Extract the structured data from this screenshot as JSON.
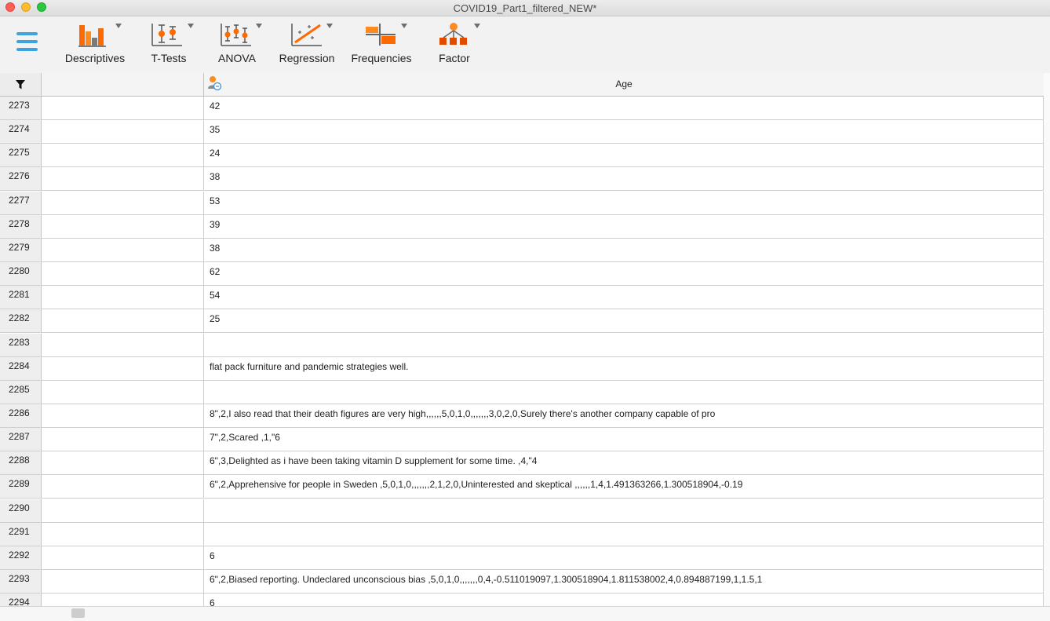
{
  "window": {
    "title": "COVID19_Part1_filtered_NEW*"
  },
  "ribbon": {
    "tools": [
      {
        "label": "Descriptives"
      },
      {
        "label": "T-Tests"
      },
      {
        "label": "ANOVA"
      },
      {
        "label": "Regression"
      },
      {
        "label": "Frequencies"
      },
      {
        "label": "Factor"
      }
    ]
  },
  "grid": {
    "column_header": "Age",
    "rows": [
      {
        "n": "2273",
        "value": "42"
      },
      {
        "n": "2274",
        "value": "35"
      },
      {
        "n": "2275",
        "value": "24"
      },
      {
        "n": "2276",
        "value": "38"
      },
      {
        "n": "2277",
        "value": "53"
      },
      {
        "n": "2278",
        "value": "39"
      },
      {
        "n": "2279",
        "value": "38"
      },
      {
        "n": "2280",
        "value": "62"
      },
      {
        "n": "2281",
        "value": "54"
      },
      {
        "n": "2282",
        "value": "25"
      },
      {
        "n": "2283",
        "value": ""
      },
      {
        "n": "2284",
        "value": "flat pack furniture and pandemic strategies well."
      },
      {
        "n": "2285",
        "value": ""
      },
      {
        "n": "2286",
        "value": "8\",2,I also read that their death figures are very high,,,,,,5,0,1,0,,,,,,,3,0,2,0,Surely there's another company capable of pro"
      },
      {
        "n": "2287",
        "value": "7\",2,Scared ,1,\"6"
      },
      {
        "n": "2288",
        "value": "6\",3,Delighted as i have been taking vitamin D supplement for some time. ,4,\"4"
      },
      {
        "n": "2289",
        "value": "6\",2,Apprehensive for people in Sweden ,5,0,1,0,,,,,,,2,1,2,0,Uninterested and skeptical ,,,,,,1,4,1.491363266,1.300518904,-0.19"
      },
      {
        "n": "2290",
        "value": ""
      },
      {
        "n": "2291",
        "value": ""
      },
      {
        "n": "2292",
        "value": "6"
      },
      {
        "n": "2293",
        "value": "6\",2,Biased reporting. Undeclared unconscious bias ,5,0,1,0,,,,,,,0,4,-0.511019097,1.300518904,1.811538002,4,0.894887199,1,1.5,1"
      },
      {
        "n": "2294",
        "value": "6"
      }
    ]
  }
}
